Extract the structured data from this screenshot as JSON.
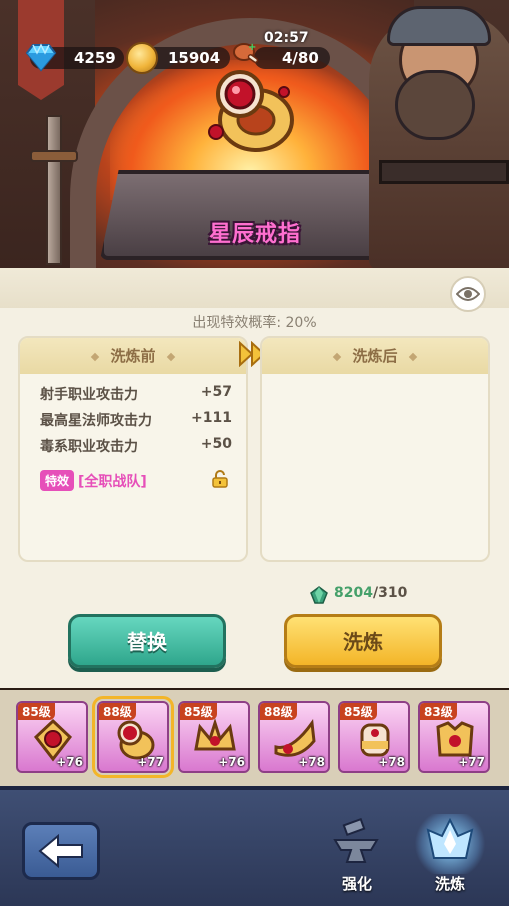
{
  "header": {
    "timer": "02:57",
    "gems": "4259",
    "coins": "15904",
    "stamina": "4/80",
    "gem_icon": "diamond-icon",
    "coin_icon": "gold-coin-icon",
    "stamina_icon": "meat-icon"
  },
  "item": {
    "name": "星辰戒指",
    "name_color": "#ff6fd0"
  },
  "refine": {
    "probability_text": "出现特效概率: 20%",
    "before_title": "洗炼前",
    "after_title": "洗炼后",
    "stats": [
      {
        "label": "射手职业攻击力",
        "value": "+57"
      },
      {
        "label": "最高星法师攻击力",
        "value": "+111"
      },
      {
        "label": "毒系职业攻击力",
        "value": "+50"
      }
    ],
    "special_badge": "特效",
    "special_text": "[全职战队]",
    "cost_current": "8204",
    "cost_required": "/310",
    "replace_label": "替换",
    "refine_label": "洗炼"
  },
  "equipment": [
    {
      "level": "85级",
      "bonus": "+76",
      "selected": false
    },
    {
      "level": "88级",
      "bonus": "+77",
      "selected": true
    },
    {
      "level": "85级",
      "bonus": "+76",
      "selected": false
    },
    {
      "level": "88级",
      "bonus": "+78",
      "selected": false
    },
    {
      "level": "85级",
      "bonus": "+78",
      "selected": false
    },
    {
      "level": "83级",
      "bonus": "+77",
      "selected": false
    }
  ],
  "nav": {
    "enhance_label": "强化",
    "refine_label": "洗炼"
  },
  "colors": {
    "accent_green": "#2fa68c",
    "accent_gold": "#f3b528",
    "special_pink": "#e64fb9",
    "cost_green": "#45a06a"
  }
}
